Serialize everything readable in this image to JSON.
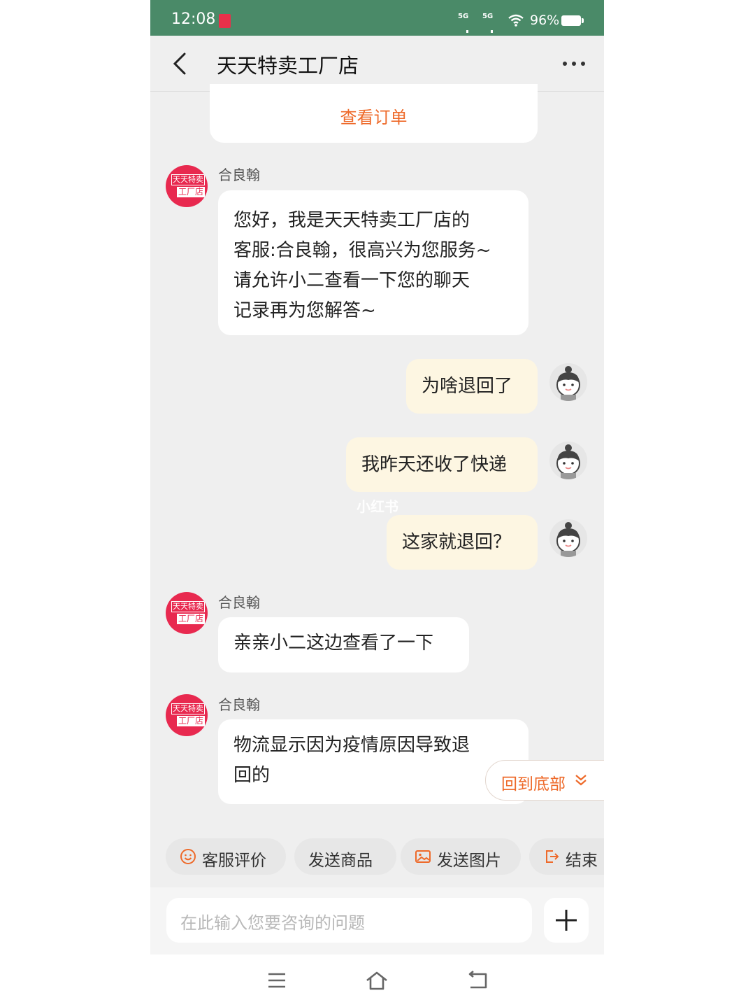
{
  "status_bar": {
    "time": "12:08",
    "network_1": "5G",
    "network_2": "5G",
    "battery_pct": "96%"
  },
  "header": {
    "title": "天天特卖工厂店",
    "back_icon": "chevron-left-icon",
    "more_icon": "more-horizontal-icon"
  },
  "order_card": {
    "label": "查看订单"
  },
  "shop_avatar": {
    "line1": "天天特卖",
    "line2": "工厂店"
  },
  "messages": [
    {
      "from": "agent",
      "sender": "合良翰",
      "lines": [
        "您好，我是天天特卖工厂店的",
        "客服:合良翰，很高兴为您服务~",
        "请允许小二查看一下您的聊天",
        "记录再为您解答~"
      ]
    },
    {
      "from": "user",
      "text": "为啥退回了"
    },
    {
      "from": "user",
      "text": "我昨天还收了快递"
    },
    {
      "from": "user",
      "text": "这家就退回？"
    },
    {
      "from": "agent",
      "sender": "合良翰",
      "lines": [
        "亲亲小二这边查看了一下"
      ]
    },
    {
      "from": "agent",
      "sender": "合良翰",
      "lines": [
        "物流显示因为疫情原因导致退",
        "回的"
      ]
    }
  ],
  "watermark": "小红书",
  "scroll_to_bottom": {
    "label": "回到底部"
  },
  "quick_actions": [
    {
      "label": "客服评价",
      "icon": "smiley-icon"
    },
    {
      "label": "发送商品",
      "icon": ""
    },
    {
      "label": "发送图片",
      "icon": "image-icon"
    },
    {
      "label": "结束",
      "icon": "exit-icon"
    }
  ],
  "input": {
    "placeholder": "在此输入您要咨询的问题"
  },
  "nav_bar": {
    "menu_icon": "menu-icon",
    "home_icon": "home-icon",
    "back_icon": "back-icon"
  },
  "colors": {
    "status_bar": "#4a8a68",
    "accent": "#ee6a2a",
    "user_bubble": "#fdf6e2",
    "shop_red": "#e8294f"
  }
}
